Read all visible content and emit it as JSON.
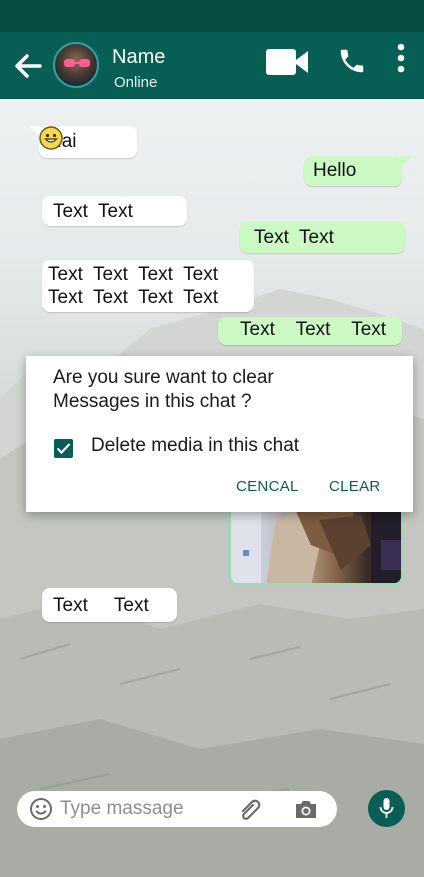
{
  "header": {
    "contact_name": "Name",
    "contact_status": "Online",
    "icons": [
      "back-arrow-icon",
      "video-call-icon",
      "phone-icon",
      "more-vert-icon"
    ]
  },
  "messages": [
    {
      "direction": "in",
      "text": "Hai",
      "emoji": "smiley-emoji"
    },
    {
      "direction": "out",
      "text": "Hello"
    },
    {
      "direction": "in",
      "text": "Text  Text"
    },
    {
      "direction": "out",
      "text": "Text  Text"
    },
    {
      "direction": "in",
      "lines": [
        "Text  Text  Text  Text",
        "Text  Text  Text  Text"
      ]
    },
    {
      "direction": "out",
      "text": "Text    Text    Text"
    },
    {
      "direction": "out",
      "type": "image"
    },
    {
      "direction": "in",
      "text": "Text     Text"
    }
  ],
  "dialog": {
    "message": "Are you sure want to clear\nMessages in this chat ?",
    "checkbox_label": "Delete media in this chat",
    "checkbox_checked": true,
    "cancel_label": "CENCAL",
    "clear_label": "CLEAR"
  },
  "composer": {
    "placeholder": "Type massage",
    "icons": [
      "emoji-icon",
      "attach-icon",
      "camera-icon",
      "mic-icon"
    ]
  },
  "colors": {
    "header": "#075e54",
    "statusbar": "#054c41",
    "outgoing_bubble": "#ccf8c4",
    "incoming_bubble": "#ffffff",
    "accent": "#075e54"
  }
}
